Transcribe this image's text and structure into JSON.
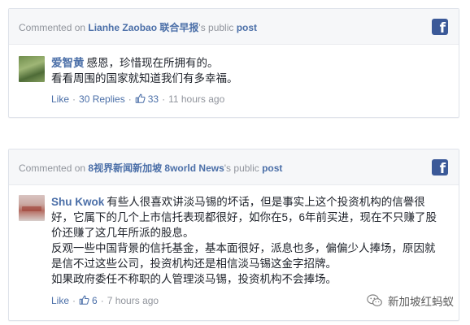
{
  "cards": [
    {
      "header": {
        "prefix": "Commented on ",
        "page_name": "Lianhe Zaobao 联合早报",
        "suffix": "'s public ",
        "post_label": "post"
      },
      "fb_icon": "facebook-icon",
      "comment": {
        "author": "爱智黄",
        "lines": [
          "感恩，珍惜现在所拥有的。",
          "看看周围的国家就知道我们有多幸福。"
        ],
        "like_label": "Like",
        "replies_label": "30 Replies",
        "like_count": "33",
        "time": "11 hours ago"
      }
    },
    {
      "header": {
        "prefix": "Commented on ",
        "page_name": "8视界新闻新加坡 8world News",
        "suffix": "'s public ",
        "post_label": "post"
      },
      "fb_icon": "facebook-icon",
      "comment": {
        "author": "Shu Kwok",
        "paragraphs": [
          "有些人很喜欢讲淡马锡的坏话，但是事实上这个投资机构的信譽很好，它属下的几个上市信托表现都很好，如你在5，6年前买进，现在不只赚了股价还赚了这几年所派的股息。",
          "反观一些中国背景的信托基金，基本面很好，派息也多，偏偏少人捧场，原因就是信不过这些公司，投资机构还是相信淡马锡这金字招牌。",
          "如果政府委任不称职的人管理淡马锡，投资机构不会捧场。"
        ],
        "like_label": "Like",
        "like_count": "6",
        "time": "7 hours ago"
      }
    }
  ],
  "watermark": {
    "icon": "wechat-icon",
    "text": "新加坡红蚂蚁"
  },
  "colors": {
    "link": "#4b6fa8",
    "meta": "#90949c",
    "facebook": "#3b5998",
    "header_bg": "#f6f7f9"
  }
}
